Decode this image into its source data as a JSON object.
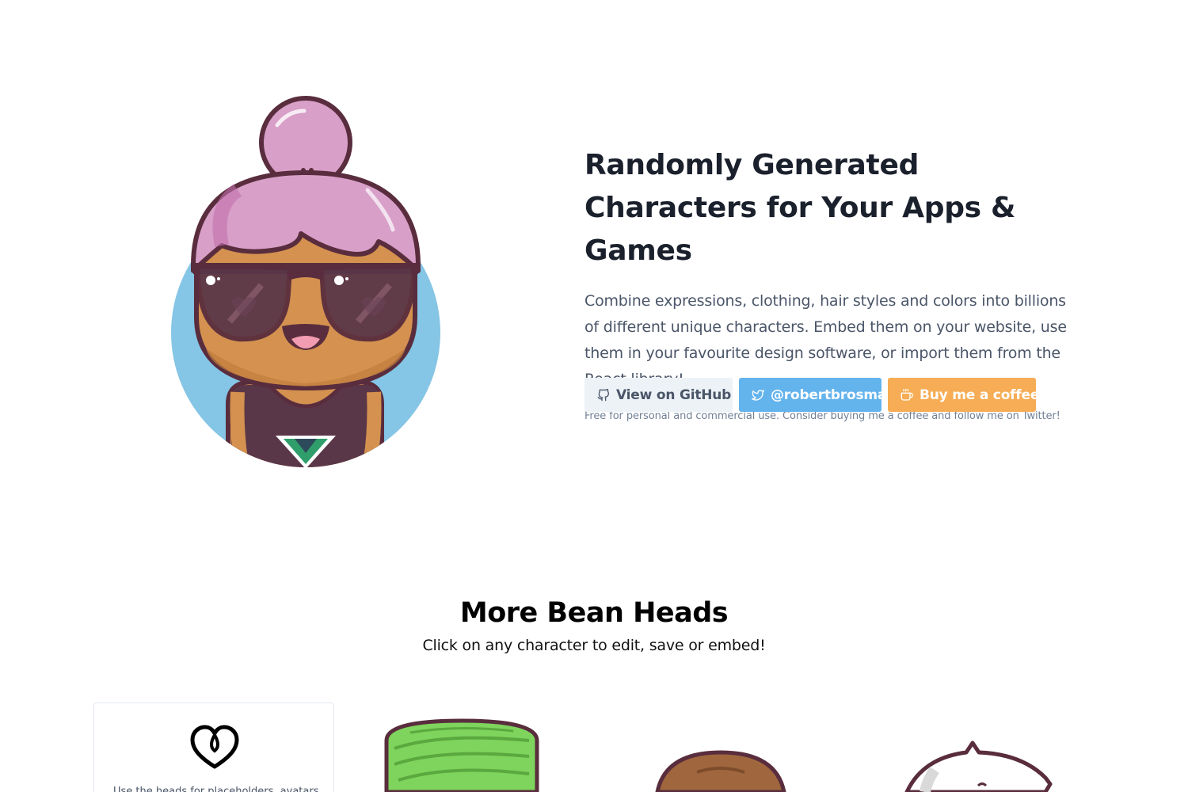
{
  "hero": {
    "title": "Randomly Generated Characters for Your Apps & Games",
    "description": "Combine expressions, clothing, hair styles and colors into billions of different unique characters. Embed them on your website, use them in your favourite design software, or import them from the React library!",
    "note": "Free for personal and commercial use. Consider buying me a coffee and follow me on Twitter!",
    "avatar_icon": "bean-head-character"
  },
  "buttons": {
    "github": {
      "label": "View on GitHub",
      "icon": "github-icon"
    },
    "twitter": {
      "label": "@robertbrosma",
      "icon": "twitter-icon"
    },
    "coffee": {
      "label": "Buy me a coffee",
      "icon": "coffee-icon"
    }
  },
  "more": {
    "title": "More Bean Heads",
    "subtitle": "Click on any character to edit, save or embed!"
  },
  "card": {
    "icon": "heart-icon",
    "text": "Use the heads for placeholders, avatars..."
  },
  "colors": {
    "github_bg": "#edf2f7",
    "twitter_bg": "#63b3ed",
    "coffee_bg": "#f6ad55",
    "avatar_circle": "#85c5e5",
    "hair": "#d89fc8",
    "skin": "#d4914f",
    "outline": "#592d3d",
    "turban": "#7ed45c"
  }
}
